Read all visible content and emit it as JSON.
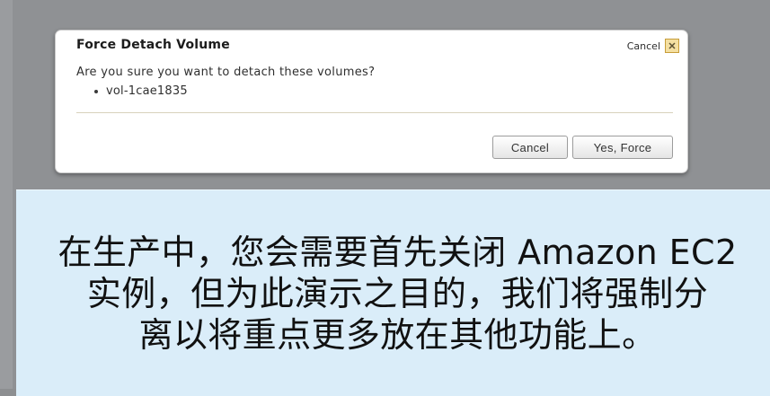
{
  "dialog": {
    "title": "Force Detach Volume",
    "cancel_link": "Cancel",
    "close_icon": "close-icon",
    "message": "Are you sure you want to detach these volumes?",
    "volumes": [
      "vol-1cae1835"
    ],
    "buttons": {
      "cancel": "Cancel",
      "confirm": "Yes, Force"
    }
  },
  "subtitle": {
    "lines": [
      "在生产中，您会需要首先关闭 Amazon EC2",
      "实例，但为此演示之目的，我们将强制分",
      "离以将重点更多放在其他功能上。"
    ]
  },
  "colors": {
    "page_background": "#8f9194",
    "dialog_background": "#ffffff",
    "subtitle_background": "#daedf9",
    "close_icon_fill": "#f4dfa1"
  }
}
